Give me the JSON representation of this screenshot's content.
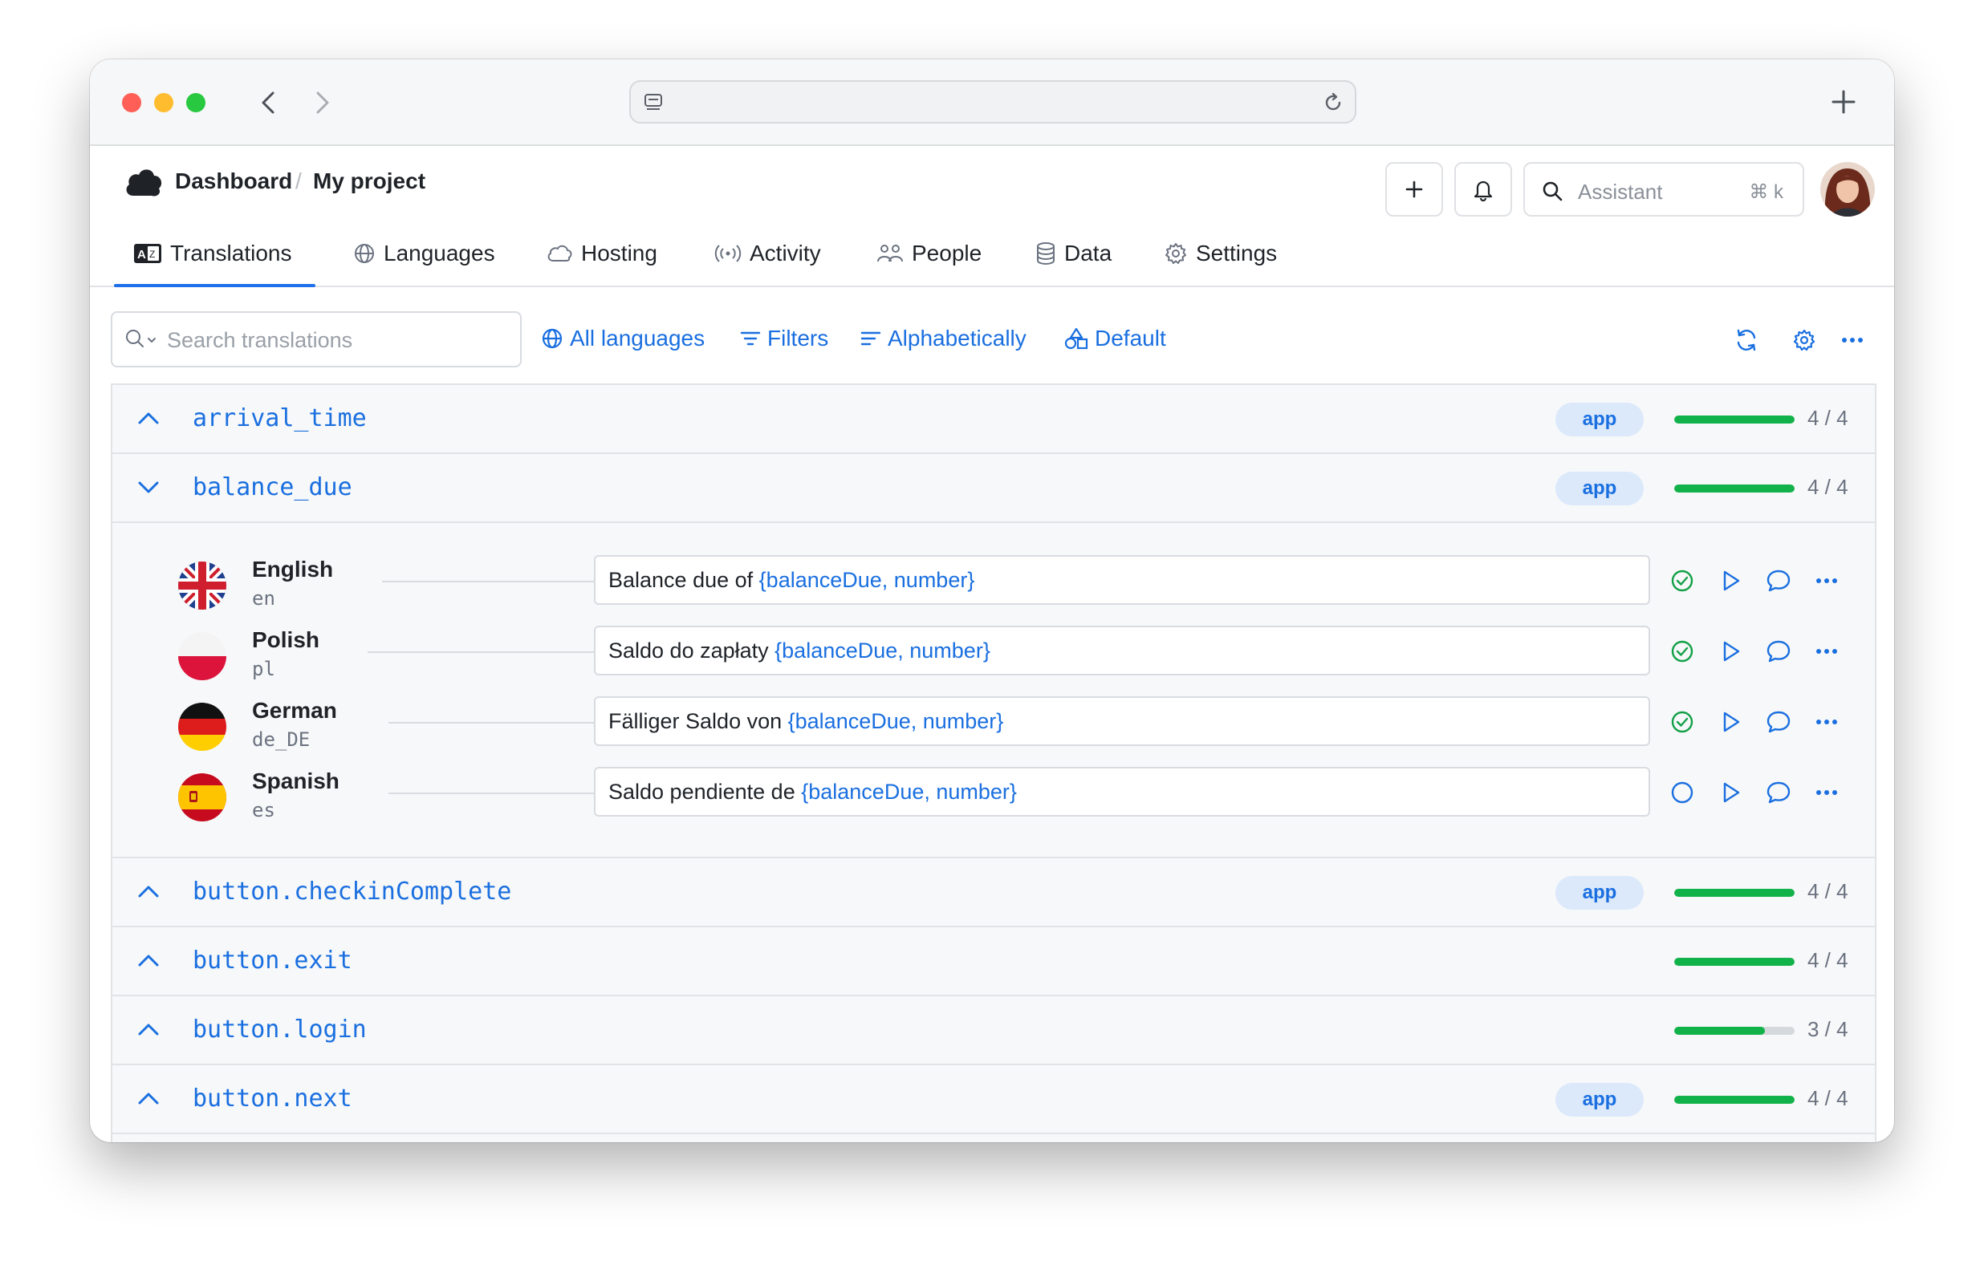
{
  "header": {
    "breadcrumb": [
      "Dashboard",
      "My project"
    ],
    "assistant": {
      "label": "Assistant",
      "shortcut": "⌘ k"
    }
  },
  "tabs": [
    {
      "label": "Translations",
      "icon": "translate-icon",
      "active": true
    },
    {
      "label": "Languages",
      "icon": "globe-icon"
    },
    {
      "label": "Hosting",
      "icon": "cloud-icon"
    },
    {
      "label": "Activity",
      "icon": "broadcast-icon"
    },
    {
      "label": "People",
      "icon": "people-icon"
    },
    {
      "label": "Data",
      "icon": "database-icon"
    },
    {
      "label": "Settings",
      "icon": "gear-icon"
    }
  ],
  "toolbar": {
    "search_placeholder": "Search translations",
    "all_languages": "All languages",
    "filters": "Filters",
    "sort": "Alphabetically",
    "view": "Default"
  },
  "keys": [
    {
      "name": "arrival_time",
      "badge": "app",
      "progress": 1.0,
      "count": "4 / 4",
      "expanded": false
    },
    {
      "name": "balance_due",
      "badge": "app",
      "progress": 1.0,
      "count": "4 / 4",
      "expanded": true
    },
    {
      "name": "button.checkinComplete",
      "badge": "app",
      "progress": 1.0,
      "count": "4 / 4",
      "expanded": false
    },
    {
      "name": "button.exit",
      "badge": "",
      "progress": 1.0,
      "count": "4 / 4",
      "expanded": false
    },
    {
      "name": "button.login",
      "badge": "",
      "progress": 0.75,
      "count": "3 / 4",
      "expanded": false
    },
    {
      "name": "button.next",
      "badge": "app",
      "progress": 1.0,
      "count": "4 / 4",
      "expanded": false
    }
  ],
  "translations": [
    {
      "language": "English",
      "code": "en",
      "text": "Balance due of ",
      "placeholder": "{balanceDue, number}",
      "status": "approved"
    },
    {
      "language": "Polish",
      "code": "pl",
      "text": "Saldo do zapłaty ",
      "placeholder": "{balanceDue, number}",
      "status": "approved"
    },
    {
      "language": "German",
      "code": "de_DE",
      "text": "Fälliger Saldo von ",
      "placeholder": "{balanceDue, number}",
      "status": "approved"
    },
    {
      "language": "Spanish",
      "code": "es",
      "text": "Saldo pendiente de ",
      "placeholder": "{balanceDue, number}",
      "status": "pending"
    }
  ],
  "colors": {
    "accent": "#1a6fe0",
    "success": "#12b24a",
    "badge_bg": "#dbe9fb"
  }
}
